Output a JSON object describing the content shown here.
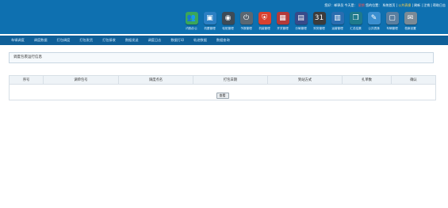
{
  "header": {
    "greeting": "您好：邮驿员",
    "today_label": "今天是：",
    "date": "星期",
    "location_label": "您的位置：",
    "location": "系统首页",
    "links": [
      "公共表操",
      "刷新",
      "注销",
      "帮助日志"
    ]
  },
  "toolbar": {
    "items": [
      {
        "label": "内勤办公",
        "icon": "people-icon",
        "color": "#3aa65a",
        "glyph": "👥"
      },
      {
        "label": "机要管理",
        "icon": "screen-icon",
        "color": "#2b7fc3",
        "glyph": "▣"
      },
      {
        "label": "轮班管理",
        "icon": "camera-icon",
        "color": "#3d4b57",
        "glyph": "◉"
      },
      {
        "label": "予报管理",
        "icon": "power-icon",
        "color": "#5a6772",
        "glyph": "⏻"
      },
      {
        "label": "机装管理",
        "icon": "shield-icon",
        "color": "#d9412f",
        "glyph": "⛨"
      },
      {
        "label": "开关管理",
        "icon": "monitor-icon",
        "color": "#b33a3a",
        "glyph": "▦"
      },
      {
        "label": "分局管理",
        "icon": "book-icon",
        "color": "#374a8a",
        "glyph": "▤"
      },
      {
        "label": "财务管理",
        "icon": "calendar-icon",
        "color": "#3c3c3c",
        "glyph": "31"
      },
      {
        "label": "运营管理",
        "icon": "chart-icon",
        "color": "#2a6db0",
        "glyph": "▥"
      },
      {
        "label": "汇总结果",
        "icon": "folder-icon",
        "color": "#1f7a8c",
        "glyph": "❒"
      },
      {
        "label": "公共表操",
        "icon": "brush-icon",
        "color": "#3b8fd0",
        "glyph": "✎"
      },
      {
        "label": "车辆管理",
        "icon": "box-icon",
        "color": "#5b7fa0",
        "glyph": "▢"
      },
      {
        "label": "档案设置",
        "icon": "document-icon",
        "color": "#7a8a96",
        "glyph": "✉"
      }
    ]
  },
  "subnav": {
    "items": [
      "车辆调度",
      "调度数据",
      "打包调度",
      "打包发货",
      "打包接收",
      "数据发送",
      "调度日志",
      "数据打印",
      "轨迹数据",
      "数据查询"
    ]
  },
  "search": {
    "label": "调度包裹运行信息"
  },
  "table": {
    "headers": [
      "序号",
      "调单包号",
      "调度点名",
      "打包日期",
      "到站方式",
      "扎单数",
      "确认"
    ],
    "query_button": "查看"
  },
  "colors": {
    "header_bg": "#0e70b0",
    "subnav_bg": "#0f5f98",
    "table_header_bg": "#eef3f7"
  }
}
